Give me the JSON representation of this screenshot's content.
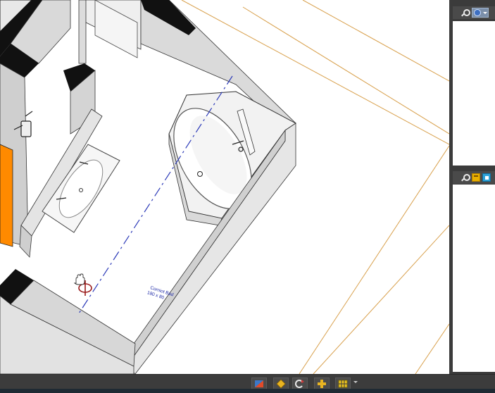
{
  "viewport": {
    "annotation": {
      "line1": "Corniot Bad",
      "line2": "180 x 80"
    }
  },
  "right_panel": {
    "toolbar_top": {
      "icons": [
        "search-icon",
        "globe-dropdown-icon"
      ]
    },
    "toolbar_mid": {
      "icons": [
        "search-icon",
        "save-icon",
        "copy-icon"
      ]
    }
  },
  "bottom_toolbar": {
    "icons": [
      "shading-icon",
      "diamond-icon",
      "rotate-icon",
      "move-icon",
      "grid-icon"
    ]
  },
  "colors": {
    "guide_line": "#d4a24a",
    "centerline": "#2c3ab8",
    "annotation": "#1e2aa8",
    "accent_orange": "#ff8a00",
    "marker_red": "#9a1b1b"
  }
}
